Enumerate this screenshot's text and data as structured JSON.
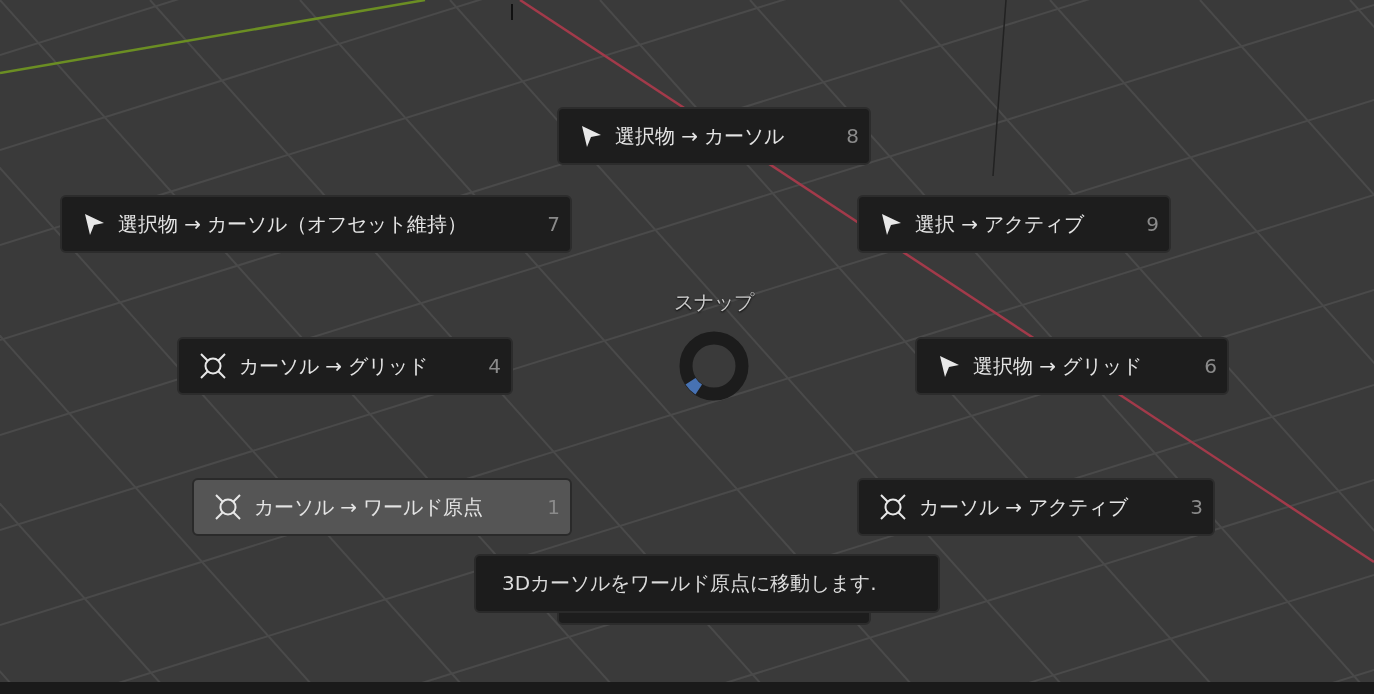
{
  "pie_menu": {
    "title": "スナップ",
    "items": [
      {
        "kind": "selection",
        "label": "選択物 → カーソル",
        "key": "8",
        "selected": false
      },
      {
        "kind": "selection",
        "label": "選択物 → カーソル（オフセット維持）",
        "key": "7",
        "selected": false
      },
      {
        "kind": "selection",
        "label": "選択 → アクティブ",
        "key": "9",
        "selected": false
      },
      {
        "kind": "cursor",
        "label": "カーソル → グリッド",
        "key": "4",
        "selected": false
      },
      {
        "kind": "selection",
        "label": "選択物 → グリッド",
        "key": "6",
        "selected": false
      },
      {
        "kind": "cursor",
        "label": "カーソル → ワールド原点",
        "key": "1",
        "selected": true
      },
      {
        "kind": "cursor",
        "label": "カーソル → アクティブ",
        "key": "3",
        "selected": false
      }
    ]
  },
  "tooltip": {
    "text": "3Dカーソルをワールド原点に移動します."
  }
}
